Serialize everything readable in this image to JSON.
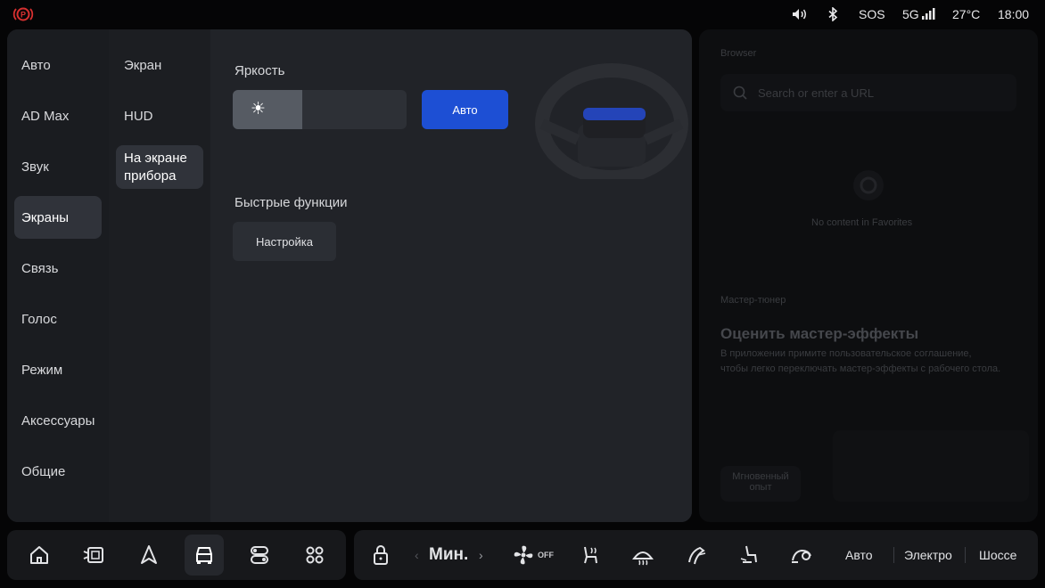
{
  "status_bar": {
    "alert_icon": "parking-brake-icon",
    "sos_label": "SOS",
    "network": "5G",
    "temperature": "27°C",
    "time": "18:00",
    "colors": {
      "alert": "#d63030"
    }
  },
  "sidebar": {
    "items": [
      {
        "label": "Авто"
      },
      {
        "label": "AD Max"
      },
      {
        "label": "Звук"
      },
      {
        "label": "Экраны",
        "active": true
      },
      {
        "label": "Связь"
      },
      {
        "label": "Голос"
      },
      {
        "label": "Режим"
      },
      {
        "label": "Аксессуары"
      },
      {
        "label": "Общие"
      }
    ]
  },
  "subnav": {
    "items": [
      {
        "label": "Экран"
      },
      {
        "label": "HUD"
      },
      {
        "label": "На экране прибора",
        "active": true
      }
    ]
  },
  "content": {
    "brightness_title": "Яркость",
    "brightness_level": 0.4,
    "auto_label": "Авто",
    "quick_title": "Быстрые функции",
    "setup_label": "Настройка",
    "colors": {
      "accent": "#1d4fd4"
    }
  },
  "browser": {
    "title": "Browser",
    "search_placeholder": "Search or enter a URL",
    "empty_text": "No content in Favorites",
    "tuner_label": "Мастер-тюнер",
    "tuner_heading": "Оценить мастер-эффекты",
    "tuner_desc_1": "В приложении примите пользовательское соглашение,",
    "tuner_desc_2": "чтобы легко переключать мастер-эффекты с рабочего стола.",
    "instant_label_1": "Мгновенный",
    "instant_label_2": "опыт"
  },
  "dock": {
    "apps": [
      "home-icon",
      "phone-icon",
      "navigation-icon",
      "car-icon",
      "toggles-icon",
      "apps-grid-icon"
    ],
    "fan_speed": "Мин.",
    "fan_off": "OFF",
    "modes": [
      "Авто",
      "Электро",
      "Шоссе"
    ]
  }
}
